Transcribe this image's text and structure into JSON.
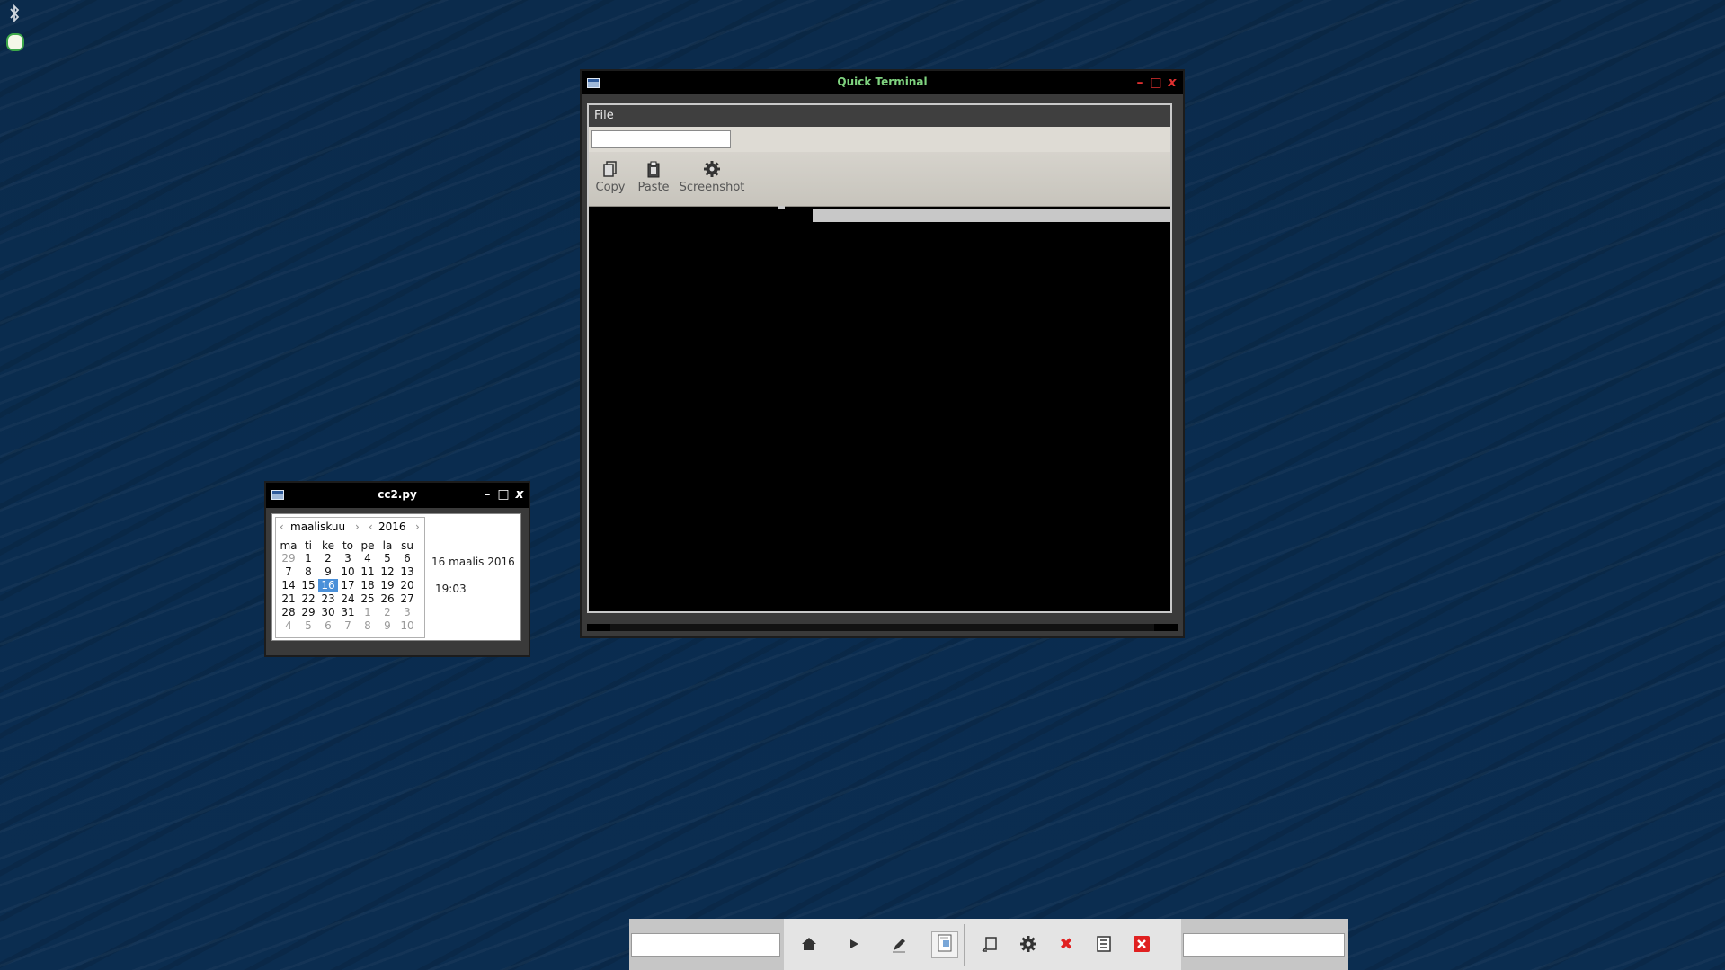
{
  "desktop": {
    "icons": [
      "bluetooth-icon",
      "app-launcher-icon"
    ],
    "background_color": "#0b2c4f"
  },
  "quick_terminal": {
    "title": "Quick Terminal",
    "title_color": "#7fd37f",
    "control_color": "#e03030",
    "menu": {
      "file_label": "File"
    },
    "address_value": "",
    "toolbar": {
      "copy_label": "Copy",
      "paste_label": "Paste",
      "screenshot_label": "Screenshot"
    }
  },
  "cc2_window": {
    "title": "cc2.py",
    "calendar": {
      "month": "maaliskuu",
      "year": "2016",
      "weekdays": [
        "ma",
        "ti",
        "ke",
        "to",
        "pe",
        "la",
        "su"
      ],
      "weeks": [
        [
          "29",
          "1",
          "2",
          "3",
          "4",
          "5",
          "6"
        ],
        [
          "7",
          "8",
          "9",
          "10",
          "11",
          "12",
          "13"
        ],
        [
          "14",
          "15",
          "16",
          "17",
          "18",
          "19",
          "20"
        ],
        [
          "21",
          "22",
          "23",
          "24",
          "25",
          "26",
          "27"
        ],
        [
          "28",
          "29",
          "30",
          "31",
          "1",
          "2",
          "3"
        ],
        [
          "4",
          "5",
          "6",
          "7",
          "8",
          "9",
          "10"
        ]
      ],
      "selected_day": "16"
    },
    "date_text": "16 maalis 2016",
    "time_text": "19:03"
  },
  "taskbar": {
    "left_field_value": "",
    "right_field_value": "",
    "icons": [
      "home-icon",
      "play-icon",
      "pen-icon",
      "document-icon",
      "new-window-icon",
      "gear-icon",
      "close-icon",
      "list-icon",
      "exit-icon"
    ],
    "accent_red": "#e02020"
  }
}
